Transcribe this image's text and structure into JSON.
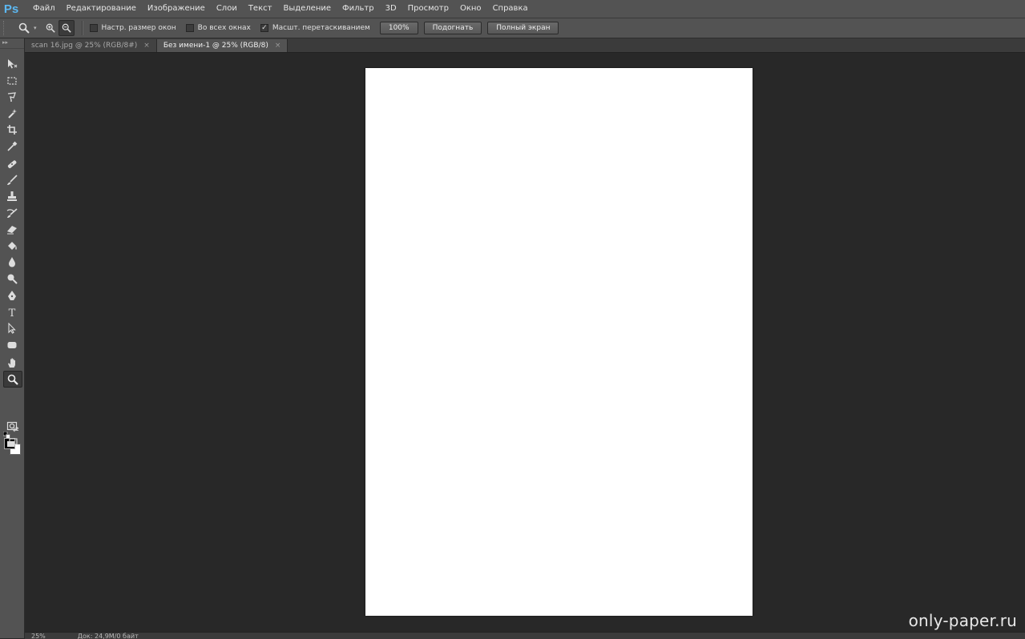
{
  "app": {
    "logo": "Ps"
  },
  "menu": [
    "Файл",
    "Редактирование",
    "Изображение",
    "Слои",
    "Текст",
    "Выделение",
    "Фильтр",
    "3D",
    "Просмотр",
    "Окно",
    "Справка"
  ],
  "options": {
    "tool_icon": "zoom-icon",
    "resize_windows_label": "Настр. размер окон",
    "resize_windows_checked": false,
    "all_windows_label": "Во всех окнах",
    "all_windows_checked": false,
    "scrubby_zoom_label": "Масшт. перетаскиванием",
    "scrubby_zoom_checked": true,
    "btn_100": "100%",
    "btn_fit": "Подогнать",
    "btn_fullscreen": "Полный экран"
  },
  "tabs": [
    {
      "label": "scan 16.jpg @ 25% (RGB/8#)",
      "active": false
    },
    {
      "label": "Без имени-1 @ 25% (RGB/8)",
      "active": true
    }
  ],
  "status": {
    "zoom": "25%",
    "doc_info": "Док: 24,9M/0 байт"
  },
  "colors": {
    "foreground": "#000000",
    "background": "#ffffff",
    "canvas": "#ffffff",
    "workspace": "#282828"
  },
  "watermark": "only-paper.ru"
}
